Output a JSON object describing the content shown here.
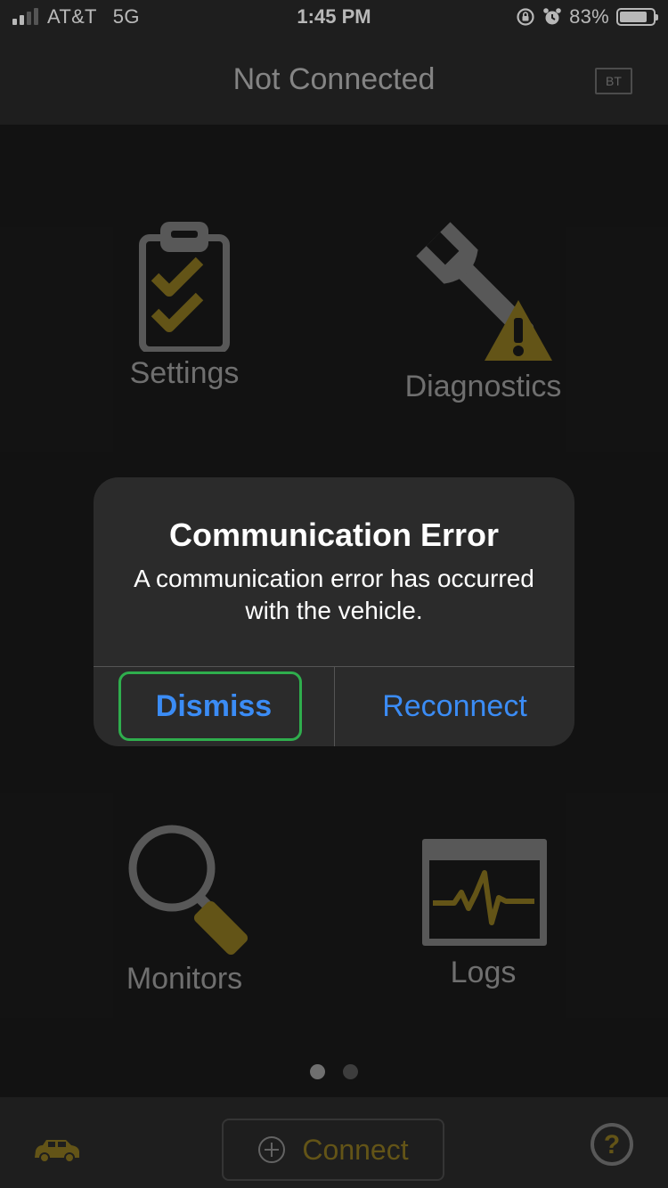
{
  "status_bar": {
    "carrier": "AT&T",
    "network": "5G",
    "time": "1:45 PM",
    "battery_percent": "83%",
    "battery_level": 0.83,
    "icons": [
      "signal-icon",
      "orientation-lock-icon",
      "alarm-icon",
      "battery-icon"
    ]
  },
  "nav": {
    "title": "Not Connected",
    "bt_badge": "BT"
  },
  "tiles": {
    "settings": {
      "label": "Settings",
      "icon": "clipboard-check-icon"
    },
    "diagnostics": {
      "label": "Diagnostics",
      "icon": "wrench-warning-icon"
    },
    "monitors": {
      "label": "Monitors",
      "icon": "magnifier-icon"
    },
    "logs": {
      "label": "Logs",
      "icon": "waveform-monitor-icon"
    }
  },
  "pager": {
    "count": 2,
    "active": 1
  },
  "bottom_bar": {
    "car_icon": "car-icon",
    "connect_label": "Connect",
    "help_icon": "help-icon"
  },
  "alert": {
    "title": "Communication Error",
    "message": "A communication error has occurred with the vehicle.",
    "dismiss_label": "Dismiss",
    "reconnect_label": "Reconnect"
  },
  "colors": {
    "background": "#1a1a1a",
    "bars": "#2a2a2a",
    "accent_gold": "#8a7520",
    "icon_gray": "#7a7a7a",
    "alert_button_blue": "#3b8cf5",
    "focus_green": "#2fae4d"
  }
}
